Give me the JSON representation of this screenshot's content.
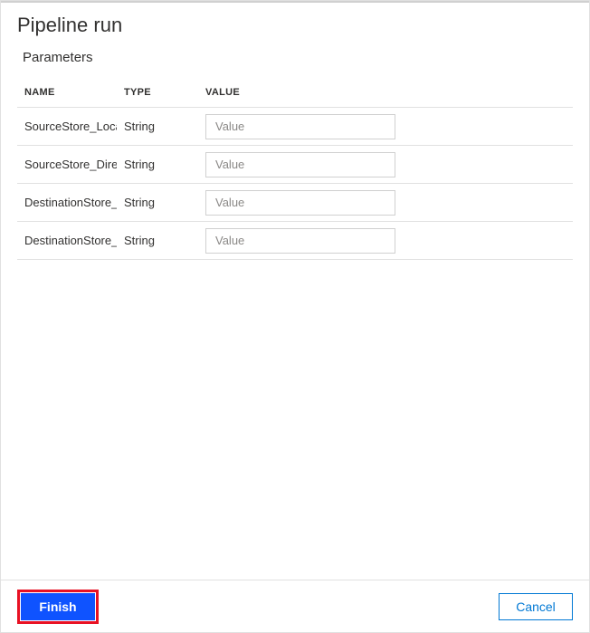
{
  "panel": {
    "title": "Pipeline run",
    "section_title": "Parameters"
  },
  "table": {
    "headers": {
      "name": "NAME",
      "type": "TYPE",
      "value": "VALUE"
    },
    "rows": [
      {
        "name": "SourceStore_Location",
        "type": "String",
        "value": "",
        "placeholder": "Value"
      },
      {
        "name": "SourceStore_Directory",
        "type": "String",
        "value": "",
        "placeholder": "Value"
      },
      {
        "name": "DestinationStore_Location",
        "type": "String",
        "value": "",
        "placeholder": "Value"
      },
      {
        "name": "DestinationStore_Directory",
        "type": "String",
        "value": "",
        "placeholder": "Value"
      }
    ]
  },
  "footer": {
    "finish_label": "Finish",
    "cancel_label": "Cancel"
  }
}
